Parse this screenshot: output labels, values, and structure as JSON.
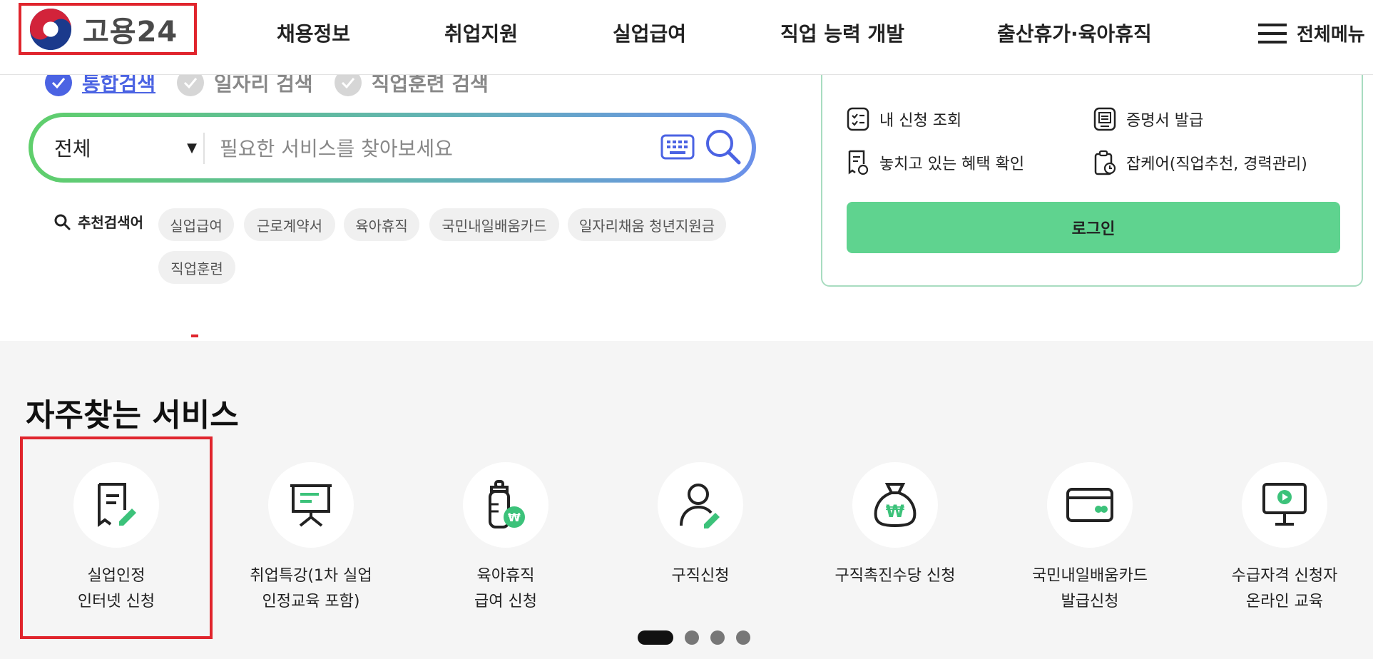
{
  "header": {
    "logo_text": "고용24",
    "nav": [
      "채용정보",
      "취업지원",
      "실업급여",
      "직업 능력 개발",
      "출산휴가·육아휴직"
    ],
    "menu_all": "전체메뉴"
  },
  "search": {
    "tabs": [
      {
        "label": "통합검색",
        "selected": true
      },
      {
        "label": "일자리 검색",
        "selected": false
      },
      {
        "label": "직업훈련 검색",
        "selected": false
      }
    ],
    "scope": "전체",
    "placeholder": "필요한 서비스를 찾아보세요",
    "recommended_label": "추천검색어",
    "keywords": [
      "실업급여",
      "근로계약서",
      "육아휴직",
      "국민내일배움카드",
      "일자리채움 청년지원금",
      "직업훈련"
    ]
  },
  "panel": {
    "items": [
      "내 신청 조회",
      "증명서 발급",
      "놓치고 있는 혜택 확인",
      "잡케어(직업추천, 경력관리)"
    ],
    "login": "로그인"
  },
  "frequent": {
    "title": "자주찾는 서비스",
    "services": [
      {
        "line1": "실업인정",
        "line2": "인터넷 신청",
        "icon": "document-edit-icon"
      },
      {
        "line1": "취업특강(1차 실업",
        "line2": "인정교육 포함)",
        "icon": "presentation-board-icon"
      },
      {
        "line1": "육아휴직",
        "line2": "급여 신청",
        "icon": "baby-bottle-won-icon"
      },
      {
        "line1": "구직신청",
        "line2": "",
        "icon": "person-edit-icon"
      },
      {
        "line1": "구직촉진수당 신청",
        "line2": "",
        "icon": "money-bag-icon"
      },
      {
        "line1": "국민내일배움카드",
        "line2": "발급신청",
        "icon": "card-icon"
      },
      {
        "line1": "수급자격 신청자",
        "line2": "온라인 교육",
        "icon": "monitor-play-icon"
      }
    ],
    "pagination": {
      "total": 4,
      "current": 1
    }
  },
  "colors": {
    "accent_blue": "#4b63e3",
    "login_green": "#5fd38f",
    "highlight_red": "#e0252d",
    "icon_green": "#3cc27a"
  }
}
